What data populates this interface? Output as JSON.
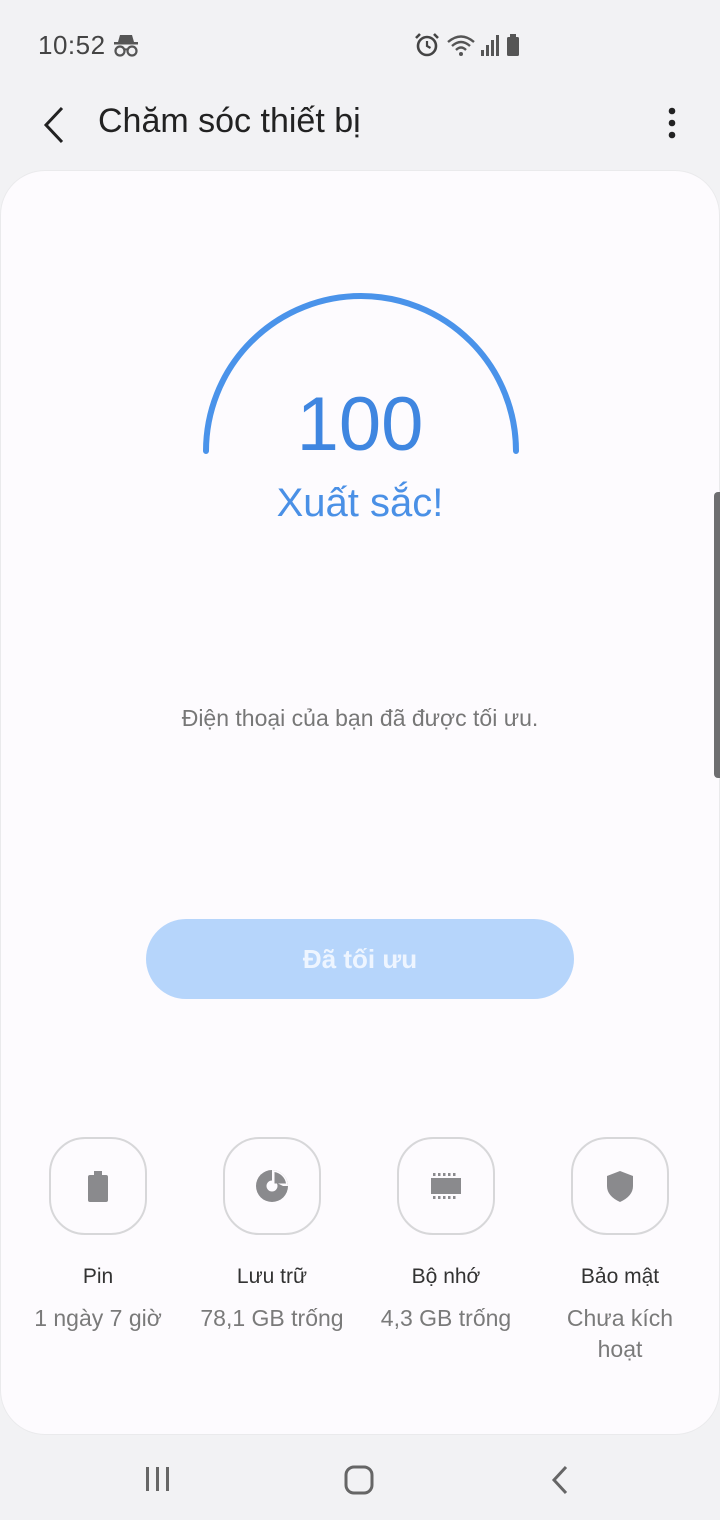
{
  "status_bar": {
    "time": "10:52",
    "icons": [
      "incognito-icon",
      "alarm-icon",
      "wifi-icon",
      "signal-icon",
      "battery-icon"
    ]
  },
  "header": {
    "title": "Chăm sóc thiết bị",
    "back_icon": "chevron-left-icon",
    "more_icon": "more-vertical-icon"
  },
  "score": {
    "value": "100",
    "label": "Xuất sắc!",
    "accent_color": "#3f86e0"
  },
  "message": "Điện thoại của bạn đã được tối ưu.",
  "optimize_button": {
    "label": "Đã tối ưu",
    "color": "#b6d5fb"
  },
  "tiles": [
    {
      "label": "Pin",
      "value": "1 ngày 7 giờ",
      "icon": "battery-icon"
    },
    {
      "label": "Lưu trữ",
      "value": "78,1 GB trống",
      "icon": "pie-chart-icon"
    },
    {
      "label": "Bộ nhớ",
      "value": "4,3 GB trống",
      "icon": "memory-chip-icon"
    },
    {
      "label": "Bảo mật",
      "value": "Chưa kích hoạt",
      "icon": "shield-icon"
    }
  ],
  "nav_bar": {
    "icons": [
      "recent-apps-icon",
      "home-icon",
      "back-icon"
    ]
  }
}
